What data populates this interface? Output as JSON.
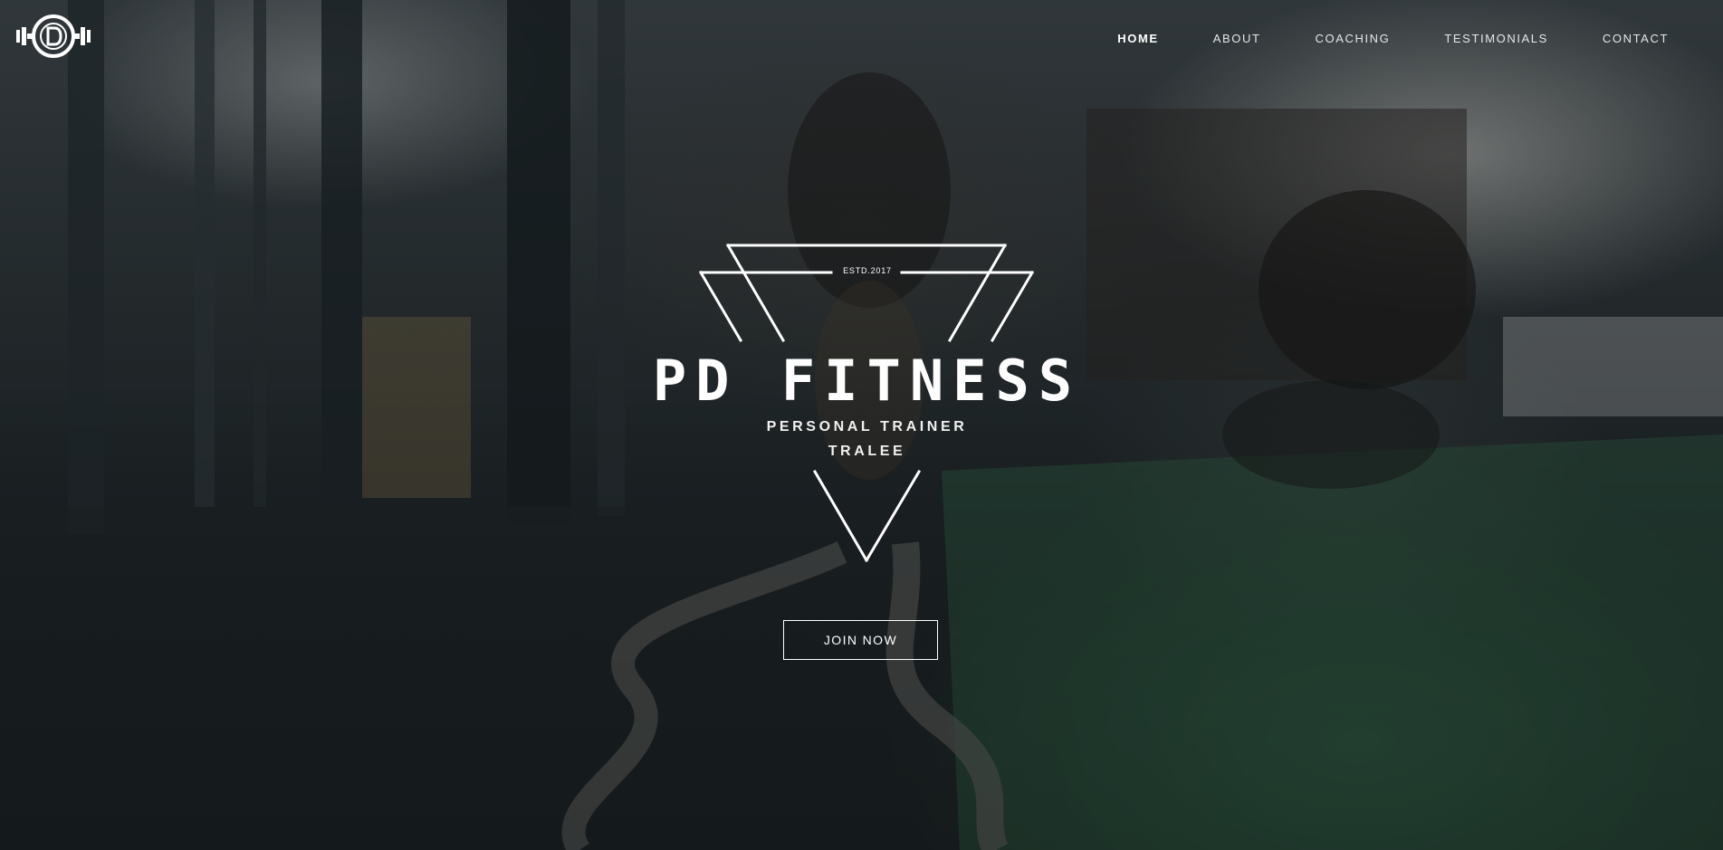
{
  "site": {
    "logo_icon": "pd-fitness-dumbbell-logo",
    "accent_color": "#ffffff"
  },
  "nav": {
    "items": [
      {
        "label": "HOME",
        "active": true
      },
      {
        "label": "ABOUT",
        "active": false
      },
      {
        "label": "COACHING",
        "active": false
      },
      {
        "label": "TESTIMONIALS",
        "active": false
      },
      {
        "label": "CONTACT",
        "active": false
      }
    ]
  },
  "hero": {
    "background": "gym-training-photo",
    "estd": "ESTD.2017",
    "title": "PD FITNESS",
    "subtitle_line1": "PERSONAL TRAINER",
    "subtitle_line2": "TRALEE",
    "cta_label": "JOIN NOW"
  }
}
